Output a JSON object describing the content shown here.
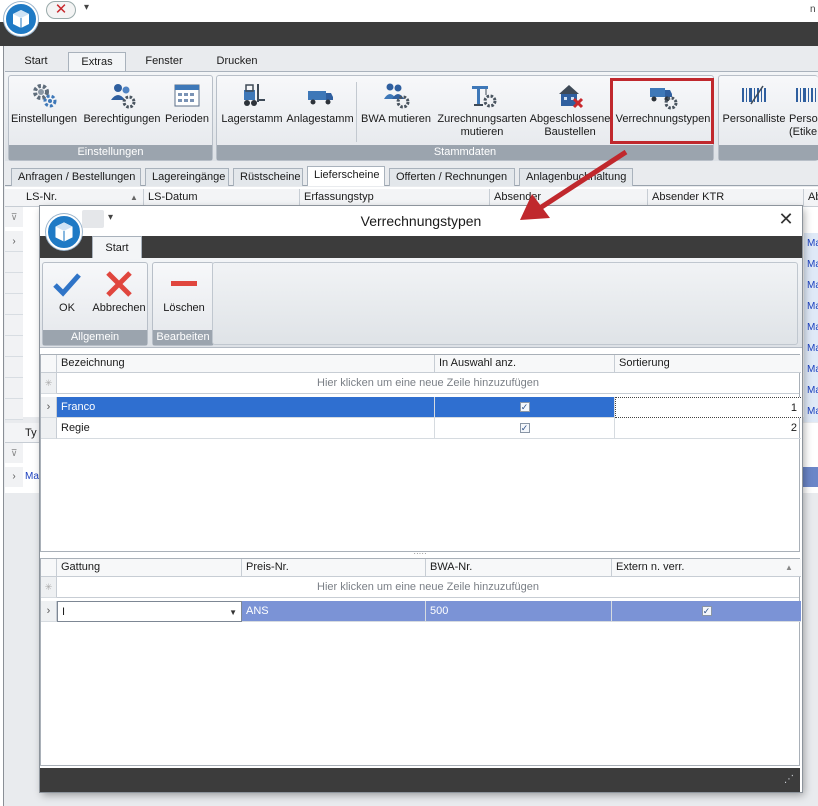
{
  "app": {
    "title_right": "n",
    "ribbon_tabs": [
      "Start",
      "Extras",
      "Fenster",
      "Drucken"
    ],
    "ribbon_groups": [
      {
        "label": "Einstellungen",
        "buttons": [
          {
            "label": "Einstellungen",
            "icon": "gears-icon"
          },
          {
            "label": "Berechtigungen",
            "icon": "users-gear-icon"
          },
          {
            "label": "Perioden",
            "icon": "calendar-icon"
          }
        ]
      },
      {
        "label": "Stammdaten",
        "buttons": [
          {
            "label": "Lagerstamm",
            "icon": "forklift-icon"
          },
          {
            "label": "Anlagestamm",
            "icon": "truck-icon"
          },
          {
            "label": "BWA mutieren",
            "icon": "people-gear-icon"
          },
          {
            "label": "Zurechnungsarten mutieren",
            "line1": "Zurechnungsarten",
            "line2": "mutieren",
            "icon": "crane-icon"
          },
          {
            "label": "Abgeschlossene Baustellen",
            "line1": "Abgeschlossene",
            "line2": "Baustellen",
            "icon": "building-x-icon"
          },
          {
            "label": "Verrechnungstypen",
            "icon": "truck-gear-icon"
          }
        ]
      },
      {
        "label": "",
        "buttons": [
          {
            "label": "Personalliste",
            "icon": "barcode-icon"
          },
          {
            "label": "Perso (Etike",
            "line1": "Perso",
            "line2": "(Etike",
            "icon": "barcode-icon"
          }
        ]
      }
    ],
    "doc_tabs": [
      "Anfragen / Bestellungen",
      "Lagereingänge",
      "Rüstscheine",
      "Lieferscheine",
      "Offerten / Rechnungen",
      "Anlagenbuchhaltung"
    ],
    "active_doc_tab": "Lieferscheine",
    "bg_columns": [
      "LS-Nr.",
      "LS-Datum",
      "Erfassungstyp",
      "Absender",
      "Absender KTR",
      "Ab"
    ],
    "bg_lower_header": "Ty",
    "bg_lower_cell": "Ma",
    "bg_right_cells": [
      "Ma",
      "Ma",
      "Ma",
      "Ma",
      "Ma",
      "Ma",
      "Ma",
      "Ma",
      "Ma"
    ]
  },
  "dialog": {
    "title": "Verrechnungstypen",
    "tab": "Start",
    "groups": [
      {
        "label": "Allgemein",
        "buttons": [
          {
            "label": "OK",
            "icon": "checkmark-icon"
          },
          {
            "label": "Abbrechen",
            "icon": "x-mark-icon"
          }
        ]
      },
      {
        "label": "Bearbeiten",
        "buttons": [
          {
            "label": "Löschen",
            "icon": "minus-icon"
          }
        ]
      }
    ],
    "grid1": {
      "columns": [
        "Bezeichnung",
        "In Auswahl anz.",
        "Sortierung"
      ],
      "new_row_hint": "Hier klicken um eine neue Zeile hinzuzufügen",
      "rows": [
        {
          "bezeichnung": "Franco",
          "in_auswahl": true,
          "sortierung": "1",
          "selected": true
        },
        {
          "bezeichnung": "Regie",
          "in_auswahl": true,
          "sortierung": "2",
          "selected": false
        }
      ]
    },
    "grid2": {
      "columns": [
        "Gattung",
        "Preis-Nr.",
        "BWA-Nr.",
        "Extern n. verr."
      ],
      "new_row_hint": "Hier klicken um eine neue Zeile hinzuzufügen",
      "rows": [
        {
          "gattung": "I",
          "preis_nr": "ANS",
          "bwa_nr": "500",
          "extern": true
        }
      ]
    }
  },
  "colors": {
    "highlight": "#c0282d",
    "selection": "#2f6fd0",
    "dark_bar": "#3c3c3c",
    "logo_blue": "#1f7ac5"
  }
}
